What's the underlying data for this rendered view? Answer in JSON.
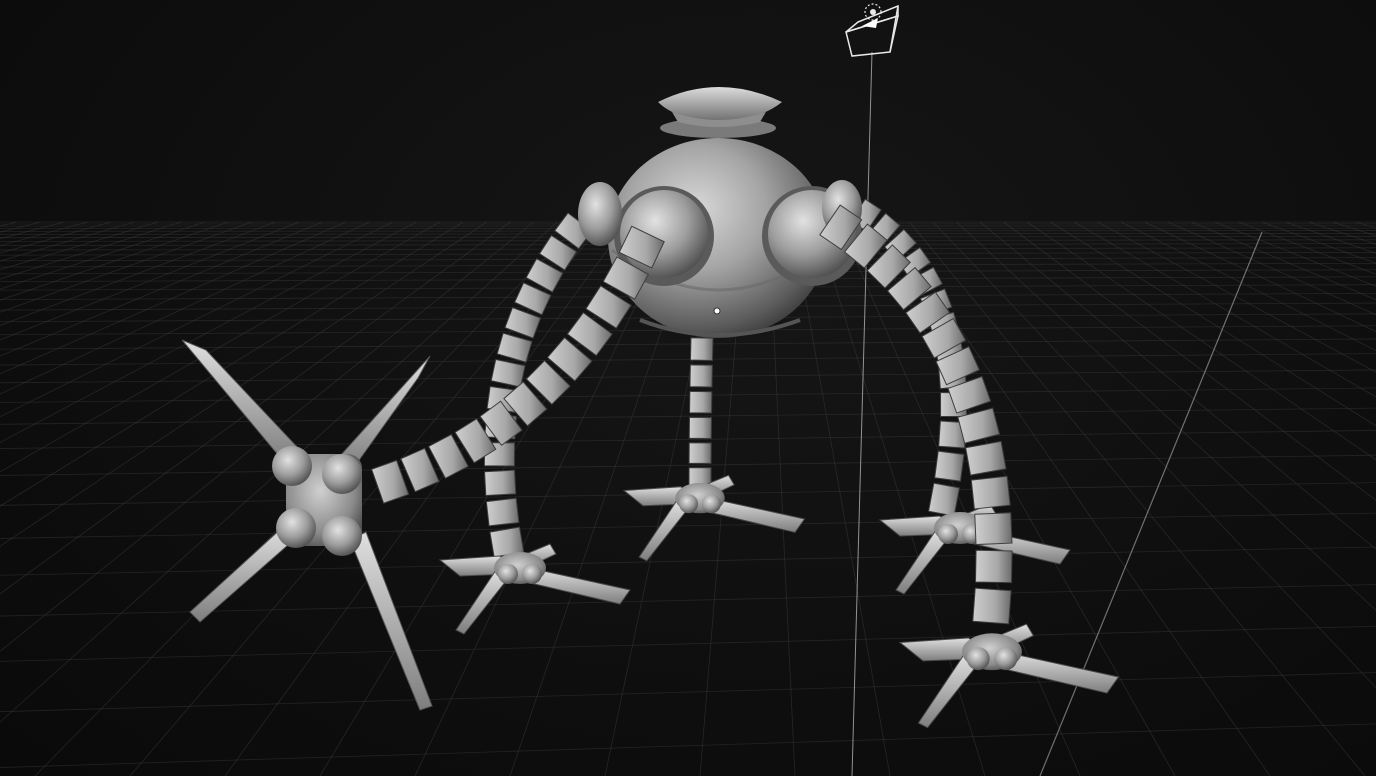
{
  "viewport": {
    "background": "#0f0f0f",
    "grid_color": "#3a3a3a",
    "model_color": "#9a9a9a",
    "camera_gizmo_color": "#e8e8e8"
  },
  "scene": {
    "model": "robot-walker-model",
    "camera": "camera-gizmo",
    "origin": "pivot-dot"
  }
}
